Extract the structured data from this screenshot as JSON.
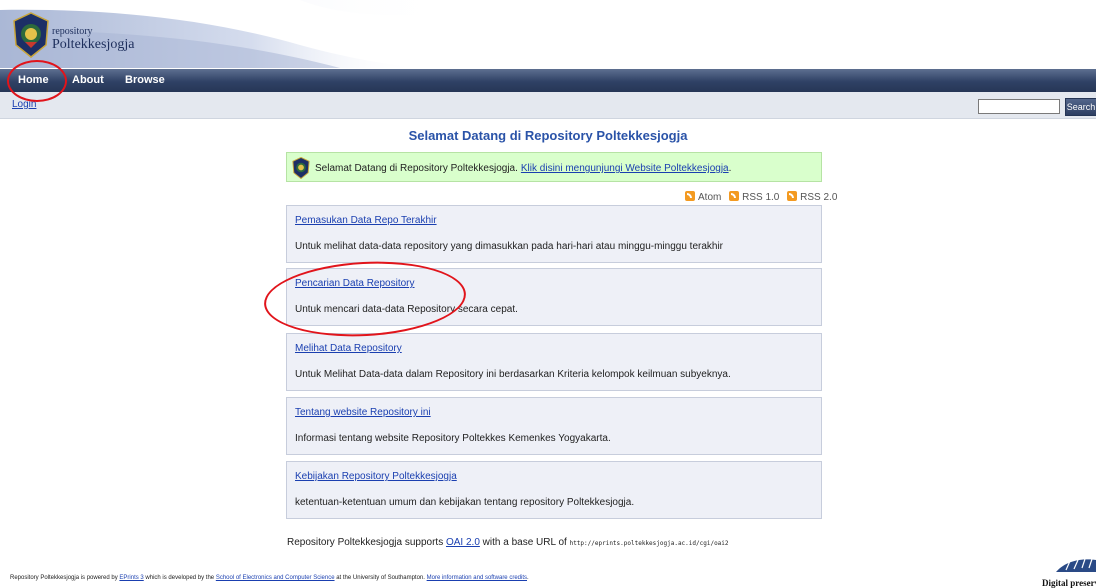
{
  "header": {
    "logo_small": "repository",
    "logo_big": "Poltekkesjogja"
  },
  "nav": {
    "items": [
      {
        "label": "Home"
      },
      {
        "label": "About"
      },
      {
        "label": "Browse"
      }
    ]
  },
  "login_bar": {
    "login_label": "Login",
    "search_value": "",
    "search_button": "Search"
  },
  "main": {
    "title": "Selamat Datang di Repository Poltekkesjogja",
    "welcome_text": "Selamat Datang di Repository Poltekkesjogja.",
    "welcome_link": "Klik disini mengunjungi Website Poltekkesjogja",
    "welcome_after": ".",
    "feeds": [
      {
        "label": "Atom"
      },
      {
        "label": "RSS 1.0"
      },
      {
        "label": "RSS 2.0"
      }
    ],
    "cards": [
      {
        "title": "Pemasukan Data Repo Terakhir",
        "desc": "Untuk melihat data-data repository yang dimasukkan pada hari-hari atau minggu-minggu terakhir"
      },
      {
        "title": "Pencarian Data Repository",
        "desc": "Untuk mencari data-data Repository secara cepat."
      },
      {
        "title": "Melihat Data Repository",
        "desc": "Untuk Melihat Data-data dalam Repository ini berdasarkan Kriteria kelompok keilmuan subyeknya."
      },
      {
        "title": "Tentang website Repository ini",
        "desc": "Informasi tentang website Repository Poltekkes Kemenkes Yogyakarta."
      },
      {
        "title": "Kebijakan Repository Poltekkesjogja",
        "desc": "ketentuan-ketentuan umum dan kebijakan tentang repository Poltekkesjogja."
      }
    ],
    "oai_prefix": "Repository Poltekkesjogja supports",
    "oai_link": "OAI 2.0",
    "oai_mid": "with a base URL of",
    "oai_url": "http://eprints.poltekkesjogja.ac.id/cgi/oai2"
  },
  "footer": {
    "t1": "Repository Poltekkesjogja is powered by",
    "l1": "EPrints 3",
    "t2": "which is developed by the",
    "l2": "School of Electronics and Computer Science",
    "t3": "at the University of Southampton.",
    "l3": "More information and software credits",
    "t4": ".",
    "dp_text": "Digital preserv"
  },
  "colors": {
    "nav_bg": "#2f4165",
    "title": "#2a53a8",
    "welcome_bg": "#d9ffcc",
    "card_bg": "#eef0f7",
    "annotation": "#e1141b",
    "link": "#1a3fb0"
  }
}
